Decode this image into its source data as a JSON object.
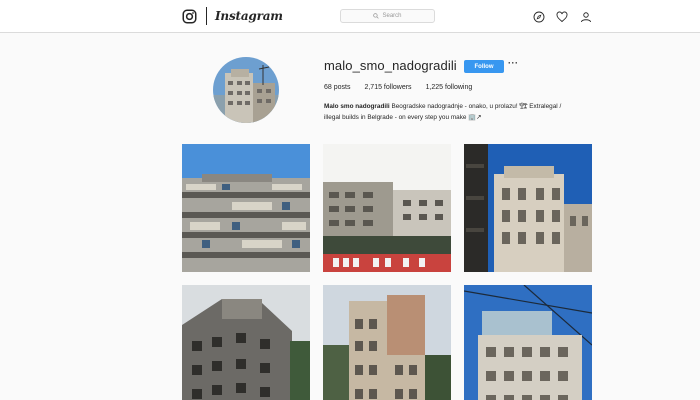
{
  "nav": {
    "wordmark": "Instagram",
    "search_placeholder": "Search",
    "icons": [
      "instagram-glyph-icon",
      "compass-icon",
      "heart-icon",
      "person-icon"
    ]
  },
  "profile": {
    "username": "malo_smo_nadogradili",
    "follow_label": "Follow",
    "more_label": "···",
    "stats": {
      "posts": "68 posts",
      "followers": "2,715 followers",
      "following": "1,225 following"
    },
    "bio_name": "Malo smo nadogradili",
    "bio_line1": " Beogradske nadogradnje - onako, u prolazu! 🏗 Extralegal /",
    "bio_line2": "illegal builds in Belgrade - on every step you make 🏢↗"
  },
  "posts": [
    {
      "label": "Post 1"
    },
    {
      "label": "Post 2"
    },
    {
      "label": "Post 3"
    },
    {
      "label": "Post 4"
    },
    {
      "label": "Post 5"
    },
    {
      "label": "Post 6"
    }
  ],
  "colors": {
    "accent": "#3897f0",
    "border": "#dbdbdb",
    "background": "#fafafa"
  }
}
